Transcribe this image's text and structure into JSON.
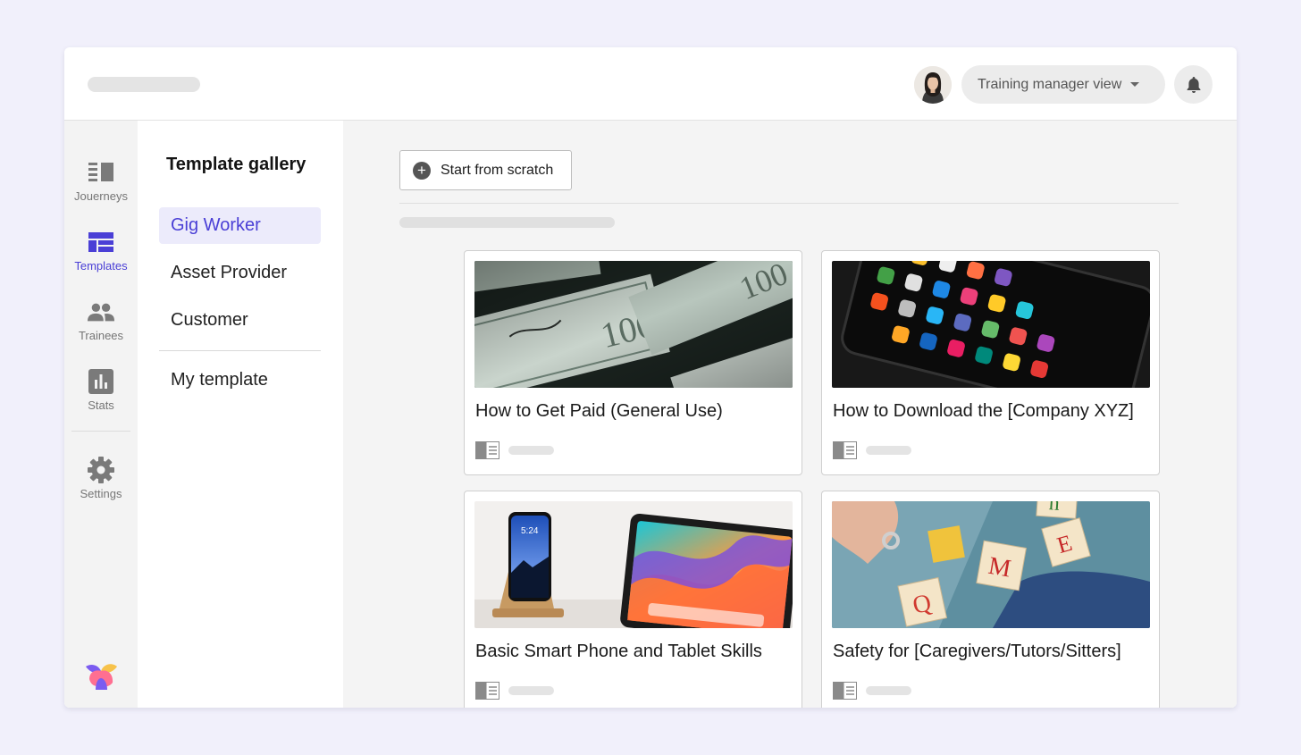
{
  "header": {
    "view_selector": {
      "label": "Training manager view",
      "icon": "caret-down-icon"
    },
    "notification_icon": "bell-icon",
    "avatar": "user-avatar"
  },
  "rail": {
    "items": [
      {
        "label": "Jouerneys",
        "icon": "journeys-icon",
        "active": false
      },
      {
        "label": "Templates",
        "icon": "templates-icon",
        "active": true
      },
      {
        "label": "Trainees",
        "icon": "trainees-icon",
        "active": false
      },
      {
        "label": "Stats",
        "icon": "stats-icon",
        "active": false
      },
      {
        "label": "Settings",
        "icon": "gear-icon",
        "active": false
      }
    ]
  },
  "gallery": {
    "title": "Template gallery",
    "categories": [
      {
        "label": "Gig Worker",
        "active": true
      },
      {
        "label": "Asset Provider",
        "active": false
      },
      {
        "label": "Customer",
        "active": false
      }
    ],
    "my_template": "My template"
  },
  "main": {
    "start_button": "Start from scratch",
    "cards": [
      {
        "title": "How to Get Paid (General Use)",
        "image": "money-bills-photo"
      },
      {
        "title": "How to Download the [Company XYZ]",
        "image": "smartphone-apps-photo"
      },
      {
        "title": "Basic Smart Phone and Tablet Skills",
        "image": "phone-tablet-photo"
      },
      {
        "title": "Safety for [Caregivers/Tutors/Sitters]",
        "image": "alphabet-blocks-photo"
      }
    ]
  },
  "colors": {
    "accent": "#4a3fd6",
    "background": "#f1f0fb",
    "active_nav_bg": "#ecebfb"
  }
}
